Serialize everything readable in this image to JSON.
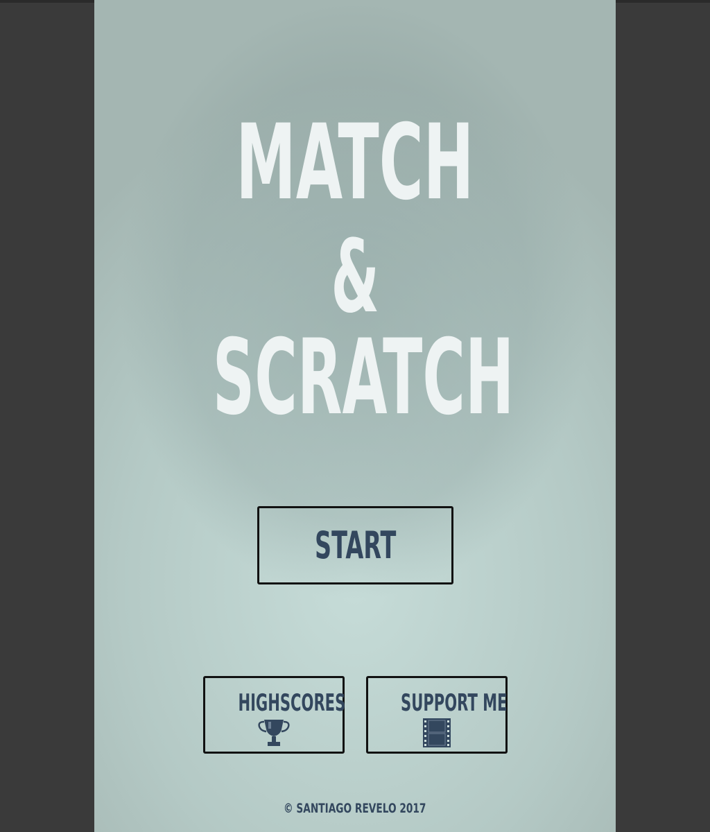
{
  "title": {
    "line1": "MATCH",
    "line2": "&",
    "line3": "SCRATCH"
  },
  "buttons": {
    "start_label": "START",
    "highscores_label": "HIGHSCORES",
    "support_label": "SUPPORT ME"
  },
  "icons": {
    "highscores": "trophy-icon",
    "support": "film-strip-icon"
  },
  "footer": {
    "copyright": "© SANTIAGO REVELO 2017"
  },
  "colors": {
    "background": "#b4c9c5",
    "title_text": "#eef3f3",
    "button_text": "#33475e",
    "button_border": "#111111",
    "outer_background": "#3a3a3a"
  }
}
